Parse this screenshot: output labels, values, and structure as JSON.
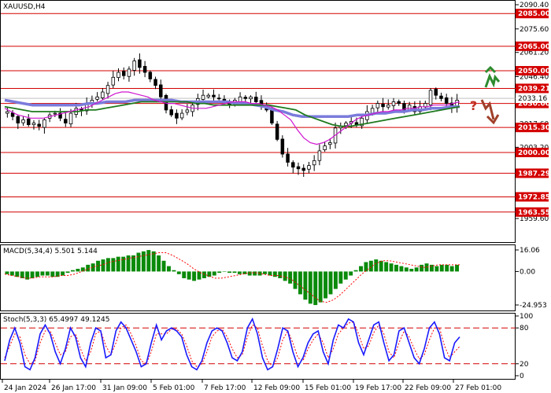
{
  "symbol_label": "XAUUSD,H4",
  "macd_label": "MACD(5,34,4) 5.501 5.144",
  "stoch_label": "Stoch(5,3,3) 65.4997 49.1245",
  "colors": {
    "level_line": "#d40000",
    "level_label_bg": "#d40000",
    "candle": "#000000",
    "ma_fast": "#d016d0",
    "ma_mid": "#1e7a1e",
    "ma_slow": "#7b7bdc",
    "macd_hist": "#0a8a0a",
    "macd_signal": "#ff0000",
    "stoch_main": "#1a1aff",
    "stoch_signal": "#ff0000",
    "arrow_up": "#2e8b2e",
    "arrow_down": "#a0402a",
    "question": "#c0301f",
    "axis": "#000000"
  },
  "icons": [
    "arrow-up-icon",
    "arrow-down-icon",
    "question-mark-icon"
  ],
  "question_mark": "?",
  "chart_data": [
    {
      "type": "candlestick",
      "title": "XAUUSD,H4",
      "ylim": [
        1959.6,
        2090.4
      ],
      "y_ticks": [
        "2090.40",
        "2075.60",
        "2061.20",
        "2046.40",
        "2032.00",
        "2017.60",
        "2003.20",
        "1988.40",
        "1974.00",
        "1959.60"
      ],
      "x_ticks": [
        "24 Jan 2024",
        "26 Jan 17:00",
        "31 Jan 09:00",
        "5 Feb 01:00",
        "7 Feb 17:00",
        "12 Feb 09:00",
        "15 Feb 01:00",
        "19 Feb 17:00",
        "22 Feb 09:00",
        "27 Feb 01:00"
      ],
      "levels": [
        {
          "value": 2085.0,
          "label": "2085.00"
        },
        {
          "value": 2065.0,
          "label": "2065.00"
        },
        {
          "value": 2050.0,
          "label": "2050.00"
        },
        {
          "value": 2039.21,
          "label": "2039.21"
        },
        {
          "value": 2030.0,
          "label": "2030.00"
        },
        {
          "value": 2015.3,
          "label": "2015.30"
        },
        {
          "value": 2000.0,
          "label": "2000.00"
        },
        {
          "value": 1987.29,
          "label": "1987.29"
        },
        {
          "value": 1972.85,
          "label": "1972.85"
        },
        {
          "value": 1963.55,
          "label": "1963.55"
        }
      ],
      "current_price": {
        "value": 2033.16,
        "label": "2033.16"
      },
      "close_path": [
        2025,
        2022,
        2018,
        2020,
        2017,
        2018,
        2016,
        2020,
        2023,
        2024,
        2021,
        2018,
        2024,
        2027,
        2026,
        2030,
        2032,
        2034,
        2037,
        2041,
        2046,
        2049,
        2047,
        2051,
        2056,
        2052,
        2049,
        2045,
        2041,
        2034,
        2026,
        2023,
        2021,
        2024,
        2026,
        2029,
        2033,
        2035,
        2035,
        2034,
        2033,
        2031,
        2029,
        2032,
        2034,
        2033,
        2034,
        2031,
        2029,
        2026,
        2018,
        2008,
        1999,
        1994,
        1991,
        1990,
        1989,
        1992,
        1995,
        2001,
        2004,
        2006,
        2015,
        2016,
        2018,
        2019,
        2017,
        2021,
        2025,
        2027,
        2030,
        2028,
        2029,
        2031,
        2030,
        2026,
        2029,
        2025,
        2028,
        2030,
        2038,
        2035,
        2033,
        2030,
        2028,
        2032
      ],
      "ma_fast": [
        2027,
        2025,
        2023,
        2022,
        2021,
        2021,
        2021,
        2022,
        2023,
        2024,
        2025,
        2026,
        2027,
        2028,
        2030,
        2032,
        2034,
        2036,
        2037,
        2037,
        2036,
        2035,
        2034,
        2032,
        2031,
        2030,
        2030,
        2029,
        2028,
        2027,
        2027,
        2027,
        2028,
        2029,
        2030,
        2031,
        2031,
        2031,
        2030,
        2030,
        2029,
        2028,
        2026,
        2023,
        2020,
        2014,
        2009,
        2006,
        2005,
        2006,
        2008,
        2011,
        2014,
        2017,
        2020,
        2022,
        2023,
        2024,
        2025,
        2025,
        2026,
        2026,
        2027,
        2027,
        2028,
        2028,
        2029,
        2029,
        2029,
        2030,
        2031
      ],
      "ma_mid": [
        2028,
        2027,
        2026,
        2025,
        2025,
        2025,
        2025,
        2025,
        2025,
        2026,
        2026,
        2027,
        2028,
        2029,
        2030,
        2031,
        2031,
        2031,
        2031,
        2031,
        2031,
        2030,
        2030,
        2029,
        2029,
        2029,
        2029,
        2029,
        2029,
        2029,
        2028,
        2027,
        2026,
        2023,
        2021,
        2019,
        2017,
        2016,
        2016,
        2017,
        2018,
        2019,
        2020,
        2021,
        2022,
        2023,
        2024,
        2025,
        2026,
        2027,
        2028
      ],
      "ma_slow": [
        2032,
        2031,
        2030,
        2029,
        2029,
        2029,
        2029,
        2029,
        2029,
        2030,
        2030,
        2031,
        2031,
        2031,
        2032,
        2032,
        2032,
        2032,
        2032,
        2031,
        2031,
        2031,
        2031,
        2031,
        2031,
        2030,
        2030,
        2029,
        2028,
        2026,
        2025,
        2023,
        2022,
        2022,
        2022,
        2022,
        2022,
        2022,
        2023,
        2023,
        2024,
        2024,
        2025,
        2025,
        2026,
        2026,
        2027,
        2027,
        2028,
        2028
      ]
    },
    {
      "type": "bar",
      "title": "MACD(5,34,4) 5.501 5.144",
      "ylim": [
        -24.953,
        16.06
      ],
      "y_ticks": [
        "16.06",
        "0.00",
        "-24.953"
      ],
      "values": [
        -2,
        -3,
        -4,
        -5,
        -6,
        -5,
        -4,
        -3,
        -3,
        -4,
        -4,
        -3,
        -1,
        1,
        2,
        3,
        5,
        6,
        8,
        9,
        10,
        10,
        11,
        11,
        12,
        12,
        14,
        15,
        16,
        15,
        12,
        8,
        4,
        1,
        -2,
        -5,
        -6,
        -7,
        -6,
        -5,
        -4,
        -3,
        -1,
        0,
        -1,
        -1,
        -2,
        -2,
        -3,
        -3,
        -3,
        -2,
        -3,
        -4,
        -5,
        -7,
        -9,
        -13,
        -17,
        -21,
        -24,
        -25,
        -23,
        -20,
        -17,
        -13,
        -9,
        -6,
        -3,
        1,
        4,
        7,
        8,
        9,
        8,
        7,
        6,
        5,
        4,
        3,
        2,
        3,
        5,
        6,
        5,
        4,
        5,
        5,
        4,
        5
      ],
      "signal": [
        -2,
        -3,
        -4,
        -5,
        -5,
        -4,
        -4,
        -4,
        -3,
        -3,
        -2,
        0,
        2,
        4,
        5,
        7,
        8,
        9,
        10,
        11,
        12,
        13,
        14,
        14,
        12,
        9,
        6,
        2,
        -1,
        -3,
        -5,
        -5,
        -4,
        -3,
        -2,
        -1,
        -1,
        -2,
        -3,
        -3,
        -4,
        -6,
        -10,
        -14,
        -18,
        -22,
        -23,
        -21,
        -17,
        -12,
        -7,
        -2,
        2,
        6,
        8,
        8,
        7,
        6,
        5,
        4,
        3,
        4,
        5,
        5,
        5,
        5
      ]
    },
    {
      "type": "line",
      "title": "Stoch(5,3,3) 65.4997 49.1245",
      "ylim": [
        0,
        100
      ],
      "y_ticks": [
        "100",
        "80",
        "20",
        "0"
      ],
      "levels": [
        80,
        20
      ],
      "main": [
        25,
        60,
        80,
        55,
        15,
        10,
        30,
        70,
        85,
        70,
        40,
        20,
        45,
        80,
        65,
        30,
        15,
        55,
        80,
        75,
        30,
        35,
        75,
        90,
        80,
        60,
        40,
        15,
        20,
        55,
        85,
        60,
        75,
        80,
        75,
        65,
        35,
        15,
        10,
        25,
        55,
        75,
        80,
        75,
        55,
        30,
        25,
        40,
        80,
        95,
        70,
        30,
        10,
        15,
        45,
        80,
        75,
        40,
        15,
        30,
        55,
        70,
        75,
        40,
        20,
        60,
        85,
        80,
        95,
        90,
        55,
        35,
        60,
        85,
        90,
        55,
        25,
        35,
        75,
        80,
        55,
        30,
        20,
        45,
        80,
        90,
        70,
        30,
        25,
        55,
        65
      ],
      "signal": [
        30,
        50,
        70,
        65,
        35,
        20,
        25,
        55,
        75,
        75,
        55,
        35,
        40,
        65,
        70,
        45,
        25,
        40,
        70,
        75,
        50,
        35,
        55,
        80,
        85,
        70,
        50,
        25,
        20,
        40,
        70,
        70,
        70,
        78,
        78,
        70,
        50,
        25,
        15,
        20,
        40,
        65,
        75,
        78,
        65,
        45,
        30,
        35,
        65,
        85,
        80,
        50,
        25,
        15,
        30,
        60,
        75,
        55,
        30,
        25,
        45,
        60,
        70,
        55,
        30,
        45,
        70,
        80,
        88,
        90,
        70,
        45,
        50,
        72,
        85,
        70,
        40,
        30,
        55,
        75,
        65,
        45,
        28,
        35,
        60,
        80,
        80,
        50,
        30,
        40,
        49
      ]
    }
  ]
}
